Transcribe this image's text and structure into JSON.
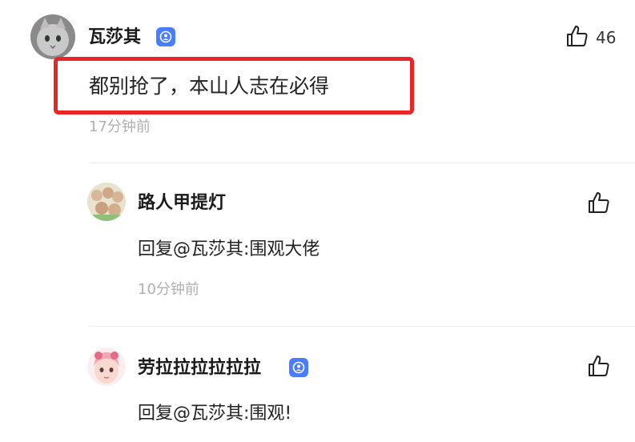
{
  "comment": {
    "author": "瓦莎其",
    "text": "都别抢了，本山人志在必得",
    "time": "17分钟前",
    "like_count": "46",
    "highlight_color": "#ea2525"
  },
  "replies": [
    {
      "author": "路人甲提灯",
      "text": "回复@瓦莎其:围观大佬",
      "time": "10分钟前"
    },
    {
      "author": "劳拉拉拉拉拉拉",
      "text": "回复@瓦莎其:围观!"
    }
  ],
  "icons": {
    "like": "thumbs-up-icon",
    "verified": "verified-badge-icon"
  },
  "colors": {
    "badge": "#4a7dff",
    "time_text": "#b0b0b0",
    "divider": "#ececec"
  }
}
